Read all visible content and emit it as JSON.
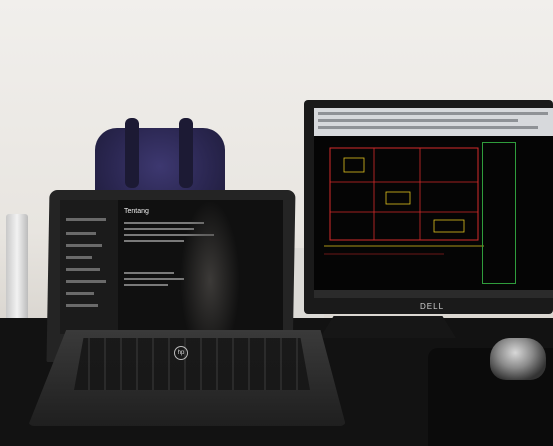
{
  "scene": {
    "brands": {
      "laptop_logo": "hp",
      "monitor_logo": "DELL"
    },
    "laptop_screen": {
      "title": "Tentang"
    },
    "colors": {
      "wall": "#ECE9E4",
      "desk": "#121212",
      "backpack": "#2A2650",
      "cad_background": "#050505",
      "cad_lines_red": "#D42A2A",
      "cad_lines_yellow": "#E0C21E",
      "cad_lines_green": "#2F9C3C"
    }
  }
}
